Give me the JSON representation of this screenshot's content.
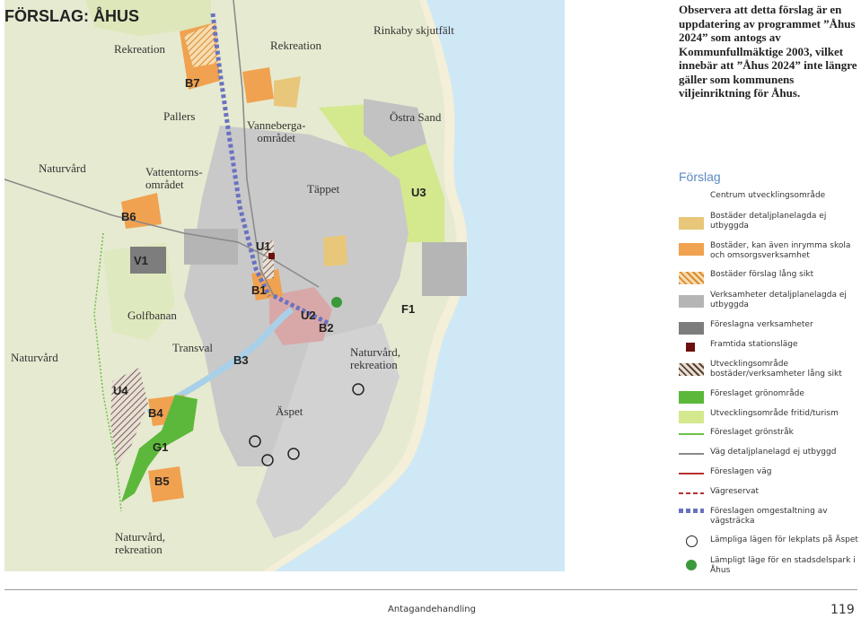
{
  "title": "FÖRSLAG: ÅHUS",
  "notice": "Observera att detta förslag är en uppdatering av programmet ”Åhus 2024” som antogs av Kommunfullmäktige 2003, vilket innebär att ”Åhus 2024” inte längre gäller som kommunens viljeinriktning för Åhus.",
  "place_labels": {
    "rekreation_1": "Rekreation",
    "rekreation_2": "Rekreation",
    "rinkaby": "Rinkaby skjutfält",
    "pallers": "Pallers",
    "vanneberga": "Vanneberga-\nområdet",
    "ostra_sand": "Östra Sand",
    "naturvard_1": "Naturvård",
    "vattentorns": "Vattentorns-\nområdet",
    "tappet": "Täppet",
    "golfbanan": "Golfbanan",
    "naturvard_2": "Naturvård",
    "transval": "Transval",
    "naturvard_rekreation_1": "Naturvård,\nrekreation",
    "aspet": "Äspet",
    "naturvard_rekreation_2": "Naturvård,\nrekreation"
  },
  "area_codes": {
    "b7": "B7",
    "b6": "B6",
    "u3": "U3",
    "v1": "V1",
    "u1": "U1",
    "b1": "B1",
    "u2": "U2",
    "b2": "B2",
    "f1": "F1",
    "b3": "B3",
    "u4": "U4",
    "b4": "B4",
    "g1": "G1",
    "b5": "B5"
  },
  "legend": {
    "title": "Förslag",
    "items": [
      {
        "label": "Centrum utvecklingsområde",
        "icon": "none"
      },
      {
        "label": "Bostäder detaljplanelagda ej utbyggda",
        "icon": "swatch-light-orange",
        "color": "#e8c77a"
      },
      {
        "label": "Bostäder, kan även inrymma skola och omsorgsverksamhet",
        "icon": "swatch-orange",
        "color": "#f0a250"
      },
      {
        "label": "Bostäder förslag lång sikt",
        "icon": "hatch-orange",
        "color": "#e8a04a"
      },
      {
        "label": "Verksamheter detaljplanelagda ej utbyggda",
        "icon": "swatch-light-gray",
        "color": "#b5b5b5"
      },
      {
        "label": "Föreslagna verksamheter",
        "icon": "swatch-dark-gray",
        "color": "#7d7d7d"
      },
      {
        "label": "Framtida stationsläge",
        "icon": "station-square",
        "color": "#6b1010"
      },
      {
        "label": "Utvecklingsområde bostäder/verksamheter lång sikt",
        "icon": "hatch-dark",
        "color": "#6a5040"
      },
      {
        "label": "Föreslaget grönområde",
        "icon": "swatch-green",
        "color": "#5cb83a"
      },
      {
        "label": "Utvecklingsområde fritid/turism",
        "icon": "swatch-light-green",
        "color": "#d4e88e"
      },
      {
        "label": "Föreslaget grönstråk",
        "icon": "line-green",
        "color": "#6cc04a"
      },
      {
        "label": "Väg detaljplanelagd ej utbyggd",
        "icon": "line-gray",
        "color": "#8a8a8a"
      },
      {
        "label": "Föreslagen väg",
        "icon": "line-red",
        "color": "#b83030"
      },
      {
        "label": "Vägreservat",
        "icon": "line-red-dashed",
        "color": "#b83030"
      },
      {
        "label": "Föreslagen omgestaltning av vägsträcka",
        "icon": "line-blue-dashed",
        "color": "#6a72c0"
      },
      {
        "label": "Lämpliga lägen för lekplats på Äspet",
        "icon": "circle-outline",
        "color": "#222222"
      },
      {
        "label": "Lämpligt läge för en stadsdelspark i Åhus",
        "icon": "circle-green",
        "color": "#3a9a3a"
      }
    ]
  },
  "footer": {
    "status": "Antagandehandling",
    "page": "119"
  }
}
